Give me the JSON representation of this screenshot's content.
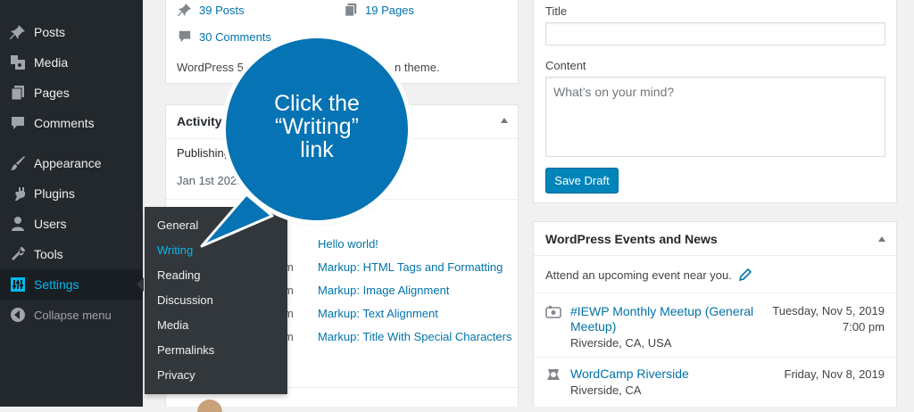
{
  "sidebar": {
    "items": [
      {
        "label": "Posts",
        "icon": "pin-icon"
      },
      {
        "label": "Media",
        "icon": "media-icon"
      },
      {
        "label": "Pages",
        "icon": "pages-icon"
      },
      {
        "label": "Comments",
        "icon": "comments-icon"
      },
      {
        "label": "Appearance",
        "icon": "brush-icon"
      },
      {
        "label": "Plugins",
        "icon": "plugin-icon"
      },
      {
        "label": "Users",
        "icon": "users-icon"
      },
      {
        "label": "Tools",
        "icon": "wrench-icon"
      },
      {
        "label": "Settings",
        "icon": "settings-icon"
      },
      {
        "label": "Collapse menu",
        "icon": "collapse-icon"
      }
    ],
    "current": "Settings"
  },
  "settings_submenu": {
    "items": [
      "General",
      "Writing",
      "Reading",
      "Discussion",
      "Media",
      "Permalinks",
      "Privacy"
    ],
    "highlighted": "Writing"
  },
  "at_a_glance": {
    "posts": "39 Posts",
    "pages": "19 Pages",
    "comments": "30 Comments",
    "version_left": "WordPress 5.2",
    "version_right": "n theme."
  },
  "activity": {
    "title": "Activity",
    "publishing": "Publishing",
    "date": "Jan 1st 2020",
    "posts": [
      {
        "time": "",
        "title": "Hello world!"
      },
      {
        "time": "m",
        "title": "Markup: HTML Tags and Formatting"
      },
      {
        "time": "m",
        "title": "Markup: Image Alignment"
      },
      {
        "time": "m",
        "title": "Markup: Text Alignment"
      },
      {
        "time": "m",
        "title": "Markup: Title With Special Characters"
      }
    ]
  },
  "quick_draft": {
    "title_label": "Title",
    "content_label": "Content",
    "content_placeholder": "What’s on your mind?",
    "save_label": "Save Draft"
  },
  "events": {
    "title": "WordPress Events and News",
    "attend": "Attend an upcoming event near you.",
    "items": [
      {
        "name": "#IEWP Monthly Meetup (General",
        "name2": "Meetup)",
        "location": "Riverside, CA, USA",
        "date": "Tuesday, Nov 5, 2019",
        "time": "7:00 pm",
        "icon": "meetup-icon"
      },
      {
        "name": "WordCamp Riverside",
        "location": "Riverside, CA",
        "date": "Friday, Nov 8, 2019",
        "icon": "wordcamp-icon"
      }
    ]
  },
  "callout": {
    "line1": "Click the",
    "line2": "“Writing”",
    "line3": "link"
  },
  "colors": {
    "sidebar_bg": "#23282d",
    "flyout_bg": "#32373c",
    "accent": "#00b9eb",
    "link": "#0073aa",
    "button": "#0085ba",
    "callout": "#0573b4"
  }
}
